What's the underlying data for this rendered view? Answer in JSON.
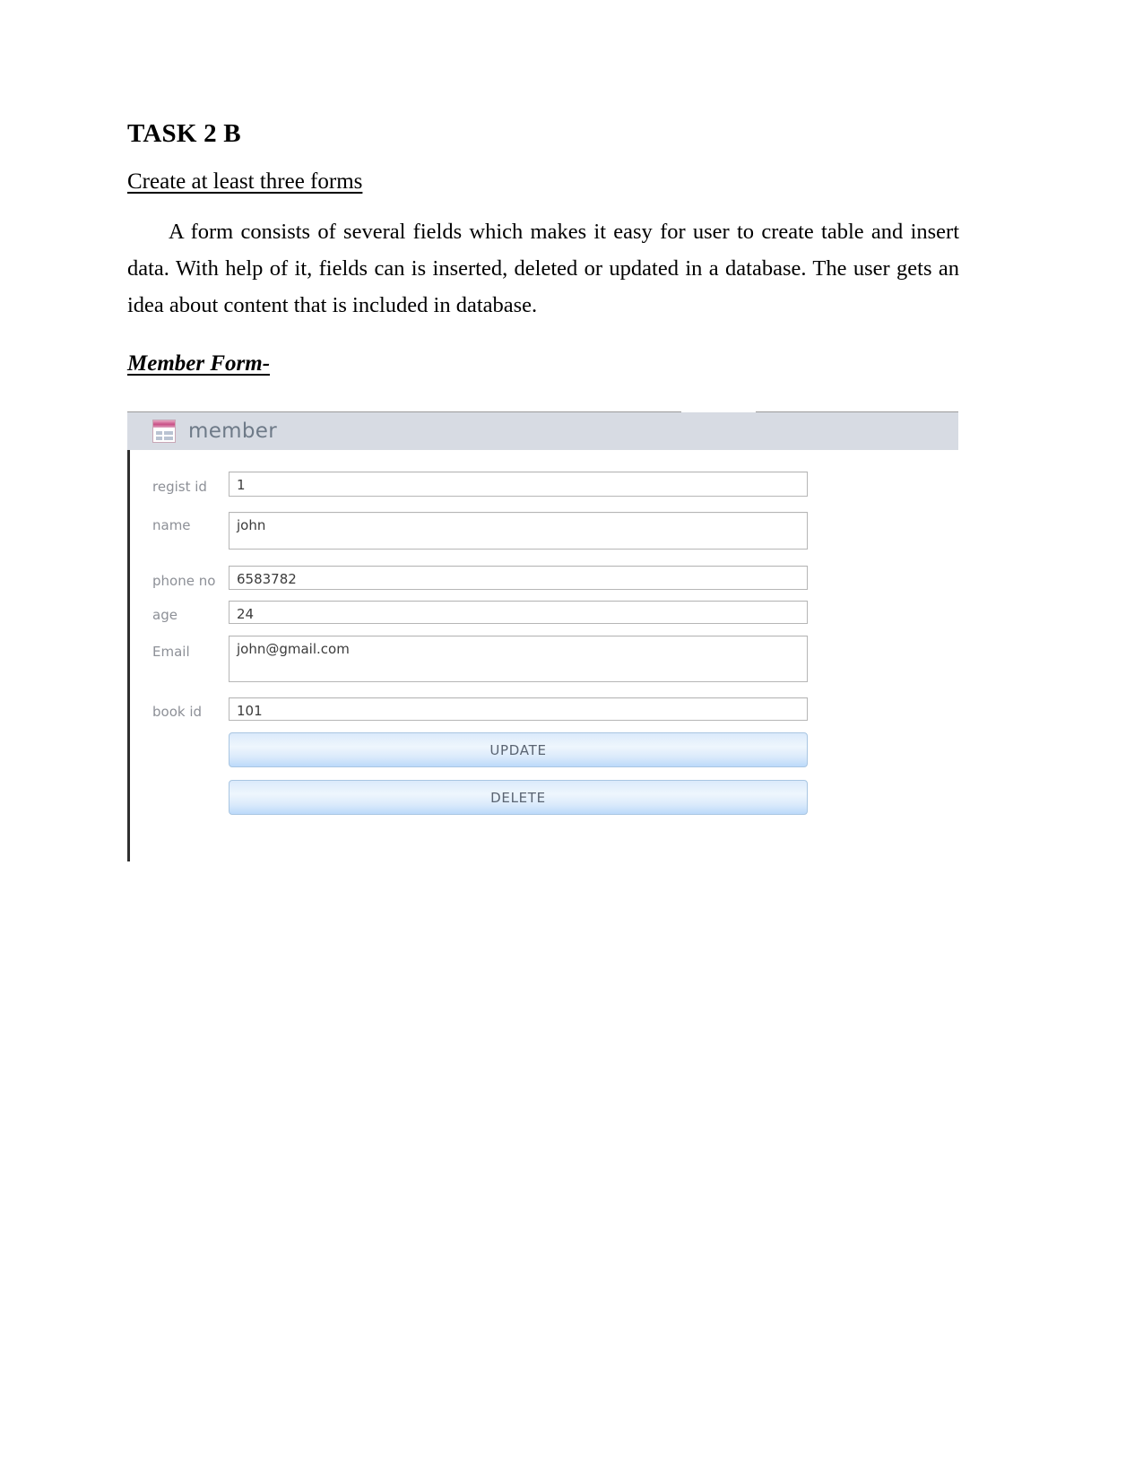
{
  "document": {
    "task_title": "TASK 2 B",
    "subtitle": "Create at least three forms",
    "paragraph": "A form consists of several fields which makes it easy for user to create table and insert data. With help of it, fields can is inserted, deleted or updated in a database. The user gets an idea about content that is included in database.",
    "member_form_heading": "Member Form-"
  },
  "screenshot": {
    "header": {
      "title": "member",
      "icon": "access-form-icon"
    },
    "fields": [
      {
        "label": "regist id",
        "value": "1"
      },
      {
        "label": "name",
        "value": "john"
      },
      {
        "label": "phone no",
        "value": "6583782"
      },
      {
        "label": "age",
        "value": "24"
      },
      {
        "label": "Email",
        "value": "john@gmail.com"
      },
      {
        "label": "book id",
        "value": "101"
      }
    ],
    "buttons": [
      {
        "label": "UPDATE"
      },
      {
        "label": "DELETE"
      }
    ],
    "colors": {
      "header_background": "#d7dbe3",
      "header_text": "#6e7a88",
      "label_text": "#8d9097",
      "value_text": "#3b3b3b",
      "button_border": "#a9c6e2",
      "button_text": "#5a6472",
      "icon_accent": "#c94f86"
    }
  }
}
